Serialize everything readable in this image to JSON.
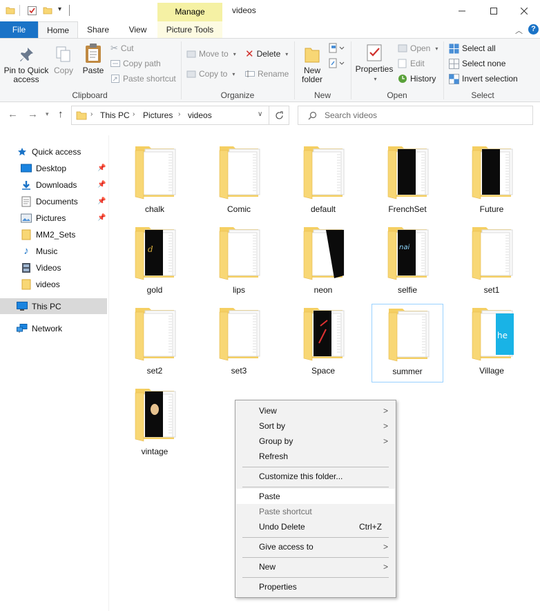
{
  "window": {
    "title": "videos",
    "manage_tab": "Manage",
    "controls": {
      "minimize": "minimize-icon",
      "maximize": "maximize-icon",
      "close": "close-icon"
    }
  },
  "tabs": [
    "File",
    "Home",
    "Share",
    "View",
    "Picture Tools"
  ],
  "ribbon": {
    "clipboard": {
      "label": "Clipboard",
      "pin": "Pin to Quick access",
      "pin_line1": "Pin to Quick",
      "pin_line2": "access",
      "copy": "Copy",
      "paste": "Paste",
      "cut": "Cut",
      "copy_path": "Copy path",
      "paste_shortcut": "Paste shortcut"
    },
    "organize": {
      "label": "Organize",
      "move_to": "Move to",
      "copy_to": "Copy to",
      "delete": "Delete",
      "rename": "Rename"
    },
    "new": {
      "label": "New",
      "new_folder_line1": "New",
      "new_folder_line2": "folder"
    },
    "open": {
      "label": "Open",
      "properties": "Properties",
      "open": "Open",
      "edit": "Edit",
      "history": "History"
    },
    "select": {
      "label": "Select",
      "select_all": "Select all",
      "select_none": "Select none",
      "invert": "Invert selection"
    }
  },
  "address": {
    "crumbs": [
      "This PC",
      "Pictures",
      "videos"
    ],
    "search_placeholder": "Search videos"
  },
  "navpane": {
    "items": [
      {
        "label": "Quick access",
        "pinned": false
      },
      {
        "label": "Desktop",
        "pinned": true
      },
      {
        "label": "Downloads",
        "pinned": true
      },
      {
        "label": "Documents",
        "pinned": true
      },
      {
        "label": "Pictures",
        "pinned": true
      },
      {
        "label": "MM2_Sets",
        "pinned": false
      },
      {
        "label": "Music",
        "pinned": false
      },
      {
        "label": "Videos",
        "pinned": false
      },
      {
        "label": "videos",
        "pinned": false
      },
      {
        "label": "This PC",
        "pinned": false
      },
      {
        "label": "Network",
        "pinned": false
      }
    ]
  },
  "folders": [
    "chalk",
    "Comic",
    "default",
    "FrenchSet",
    "Future",
    "gold",
    "lips",
    "neon",
    "selfie",
    "set1",
    "set2",
    "set3",
    "Space",
    "summer",
    "Village",
    "vintage"
  ],
  "context_menu": {
    "view": "View",
    "sort_by": "Sort by",
    "group_by": "Group by",
    "refresh": "Refresh",
    "customize": "Customize this folder...",
    "paste": "Paste",
    "paste_shortcut": "Paste shortcut",
    "undo_delete": "Undo Delete",
    "undo_shortcut": "Ctrl+Z",
    "give_access": "Give access to",
    "new": "New",
    "properties": "Properties"
  },
  "colors": {
    "file_tab": "#1a73c7",
    "manage_tab": "#f5f1a4",
    "folder_yellow": "#f8d775",
    "selection_border": "#99d1ff"
  }
}
